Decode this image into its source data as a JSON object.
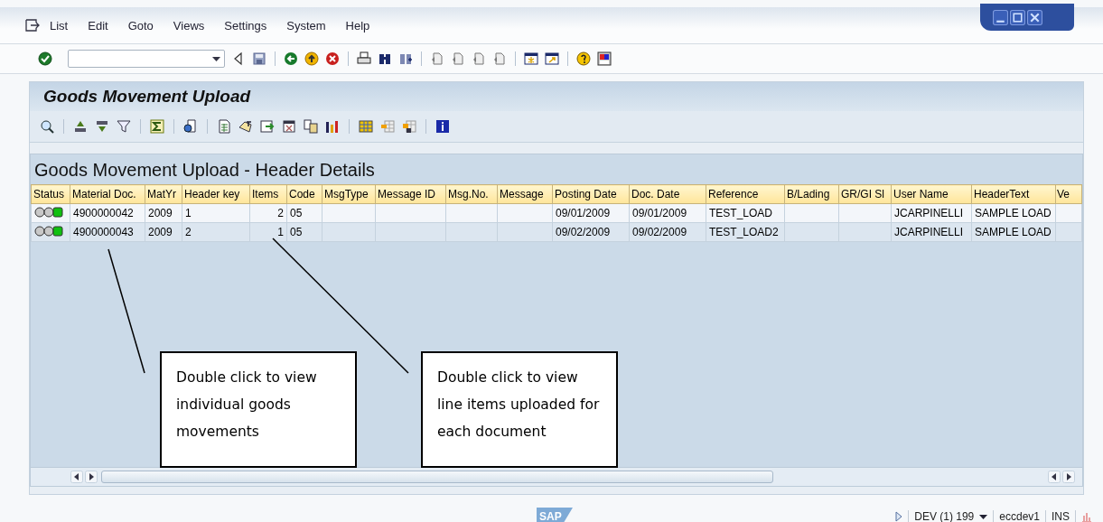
{
  "menu_bar": {
    "items": [
      "List",
      "Edit",
      "Goto",
      "Views",
      "Settings",
      "System",
      "Help"
    ]
  },
  "panel": {
    "title": "Goods Movement Upload"
  },
  "grid": {
    "title": "Goods Movement Upload - Header Details",
    "columns": [
      "Status",
      "Material Doc.",
      "MatYr",
      "Header key",
      "Items",
      "Code",
      "MsgType",
      "Message ID",
      "Msg.No.",
      "Message",
      "Posting Date",
      "Doc. Date",
      "Reference",
      "B/Lading",
      "GR/GI Sl",
      "User Name",
      "HeaderText",
      "Ve"
    ],
    "rows": [
      {
        "color": "#10c010",
        "material_doc": "4900000042",
        "mat_yr": "2009",
        "header_key": "1",
        "items": "2",
        "code": "05",
        "posting_date": "09/01/2009",
        "doc_date": "09/01/2009",
        "reference": "TEST_LOAD",
        "user_name": "JCARPINELLI",
        "header_text": "SAMPLE LOAD"
      },
      {
        "color": "#10c010",
        "material_doc": "4900000043",
        "mat_yr": "2009",
        "header_key": "2",
        "items": "1",
        "code": "05",
        "posting_date": "09/02/2009",
        "doc_date": "09/02/2009",
        "reference": "TEST_LOAD2",
        "user_name": "JCARPINELLI",
        "header_text": "SAMPLE LOAD"
      }
    ]
  },
  "callouts": [
    {
      "text": "Double click to view individual goods movements"
    },
    {
      "text": "Double click to view line items uploaded for each document"
    }
  ],
  "status_bar": {
    "logo": "SAP",
    "system": "DEV (1) 199",
    "server": "eccdev1",
    "mode": "INS"
  }
}
